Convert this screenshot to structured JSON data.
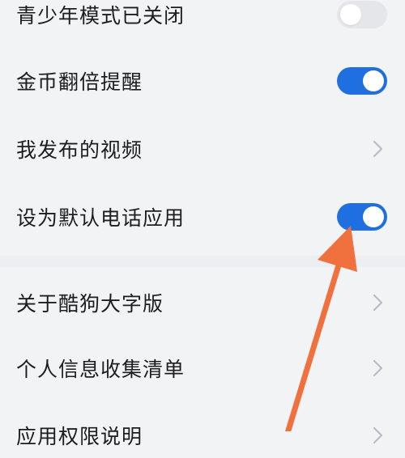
{
  "settings": {
    "group1": [
      {
        "label": "青少年模式已关闭",
        "control": "toggle",
        "state": "off"
      },
      {
        "label": "金币翻倍提醒",
        "control": "toggle",
        "state": "on"
      },
      {
        "label": "我发布的视频",
        "control": "chevron"
      },
      {
        "label": "设为默认电话应用",
        "control": "toggle",
        "state": "on"
      }
    ],
    "group2": [
      {
        "label": "关于酷狗大字版",
        "control": "chevron"
      },
      {
        "label": "个人信息收集清单",
        "control": "chevron"
      },
      {
        "label": "应用权限说明",
        "control": "chevron"
      }
    ]
  },
  "annotation": {
    "color": "#f0703e",
    "icon": "pointer-arrow-icon"
  },
  "colors": {
    "toggle_on": "#1f6fe0",
    "toggle_off": "#e5e6ea",
    "chevron": "#b9bcc4"
  }
}
